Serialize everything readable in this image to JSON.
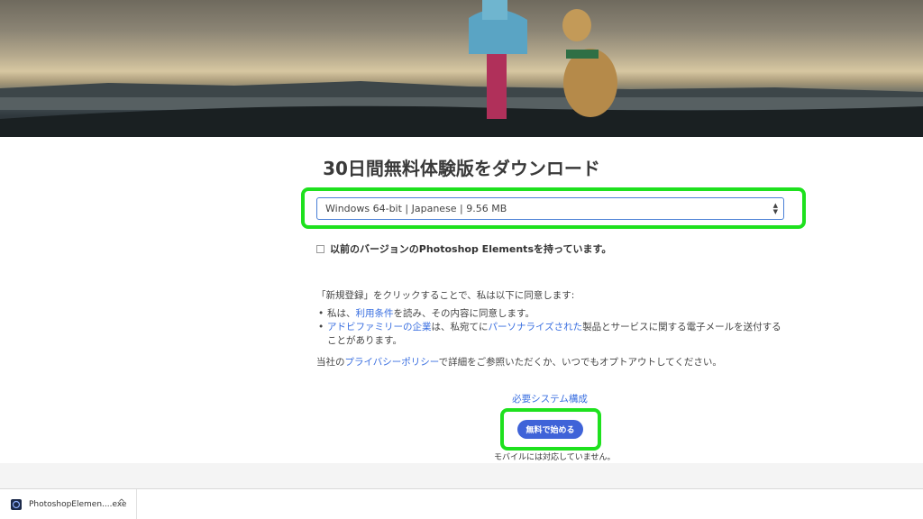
{
  "page": {
    "title": "30日間無料体験版をダウンロード"
  },
  "download_select": {
    "selected": "Windows 64-bit | Japanese | 9.56 MB"
  },
  "previous_version": {
    "label": "以前のバージョンのPhotoshop Elementsを持っています。"
  },
  "terms": {
    "intro": "「新規登録」をクリックすることで、私は以下に同意します:",
    "item1_prefix": "私は、",
    "item1_link": "利用条件",
    "item1_suffix": "を読み、その内容に同意します。",
    "item2_link1": "アドビファミリーの企業",
    "item2_mid1": "は、私宛てに",
    "item2_link2": "パーソナライズされた",
    "item2_suffix": "製品とサービスに関する電子メールを送付することがあります。",
    "privacy_prefix": "当社の",
    "privacy_link": "プライバシーポリシー",
    "privacy_suffix": "で詳細をご参照いただくか、いつでもオプトアウトしてください。",
    "bullet": "•"
  },
  "system_requirements": "必要システム構成",
  "start_button": "無料で始める",
  "mobile_note": "モバイルには対応していません。",
  "download_shelf": {
    "file_name": "PhotoshopElemen....exe",
    "chevron": "^"
  },
  "colors": {
    "highlight": "#1ee11e",
    "link": "#3a6fe0",
    "button": "#3f63d8"
  }
}
